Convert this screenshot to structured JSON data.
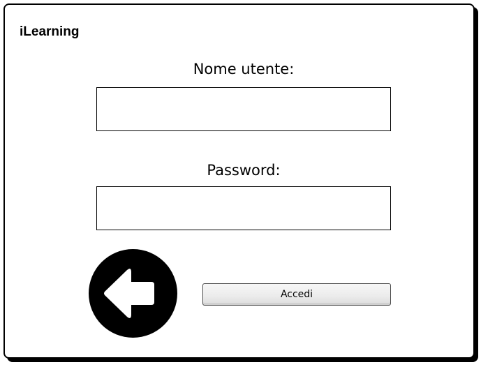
{
  "app": {
    "title": "iLearning"
  },
  "form": {
    "username_label": "Nome utente:",
    "username_value": "",
    "password_label": "Password:",
    "password_value": "",
    "submit_label": "Accedi"
  },
  "icons": {
    "back": "left-arrow-icon"
  },
  "colors": {
    "border": "#000000",
    "background": "#ffffff",
    "button_face": "#ececec"
  }
}
